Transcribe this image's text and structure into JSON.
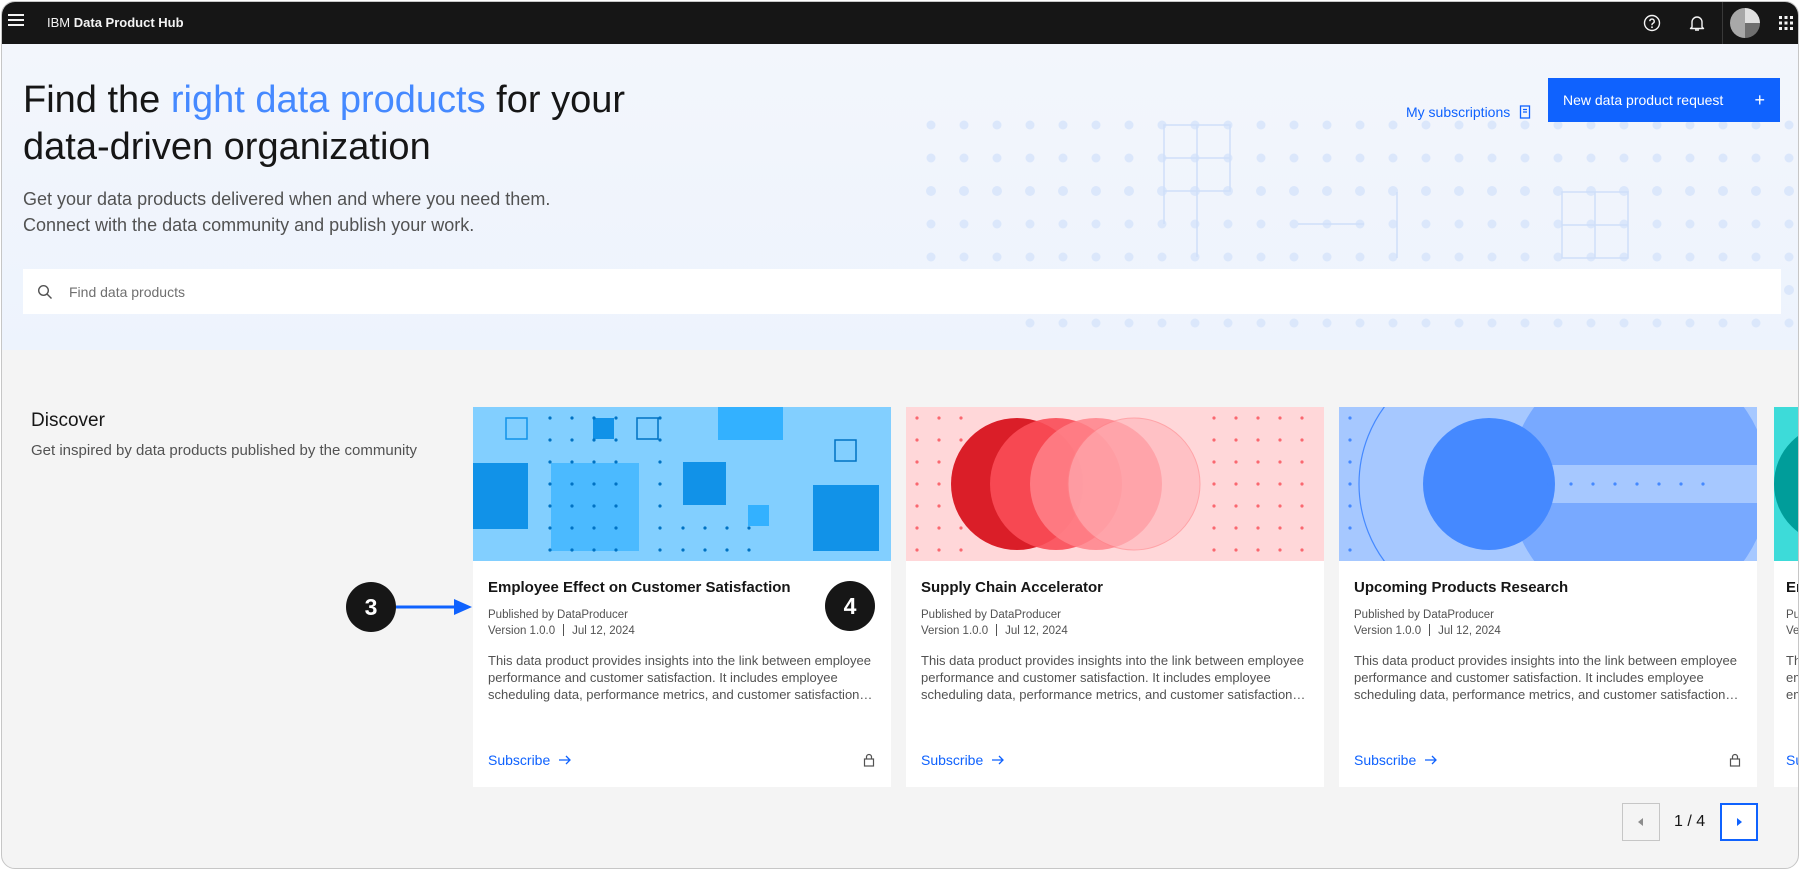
{
  "topbar": {
    "brand_prefix": "IBM",
    "brand_name": "Data Product Hub",
    "icons": [
      "menu-icon",
      "help-icon",
      "notification-icon",
      "avatar",
      "app-switcher-icon"
    ]
  },
  "hero": {
    "title_pre": "Find the ",
    "title_accent": "right data products",
    "title_post": " for your data-driven organization",
    "subtitle_line1": "Get your data products delivered when and where you need them.",
    "subtitle_line2": "Connect with the data community and publish your work.",
    "my_subscriptions": "My subscriptions",
    "new_request": "New data product request",
    "new_request_icon": "+",
    "search_placeholder": "Find data products"
  },
  "discover": {
    "title": "Discover",
    "subtitle": "Get inspired by data products published by the community"
  },
  "cards": [
    {
      "title": "Employee Effect on Customer Satisfaction",
      "publisher": "Published by DataProducer",
      "version": "Version 1.0.0",
      "date": "Jul 12, 2024",
      "description": "This data product provides insights into the link between employee performance and customer satisfaction. It includes employee scheduling data, performance metrics, and customer satisfaction data.",
      "link": "Subscribe",
      "locked": true
    },
    {
      "title": "Supply Chain Accelerator",
      "publisher": "Published by DataProducer",
      "version": "Version 1.0.0",
      "date": "Jul 12, 2024",
      "description": "This data product provides insights into the link between employee performance and customer satisfaction. It includes employee scheduling data, performance metrics, and customer satisfaction data.",
      "link": "Subscribe",
      "locked": false
    },
    {
      "title": "Upcoming Products Research",
      "publisher": "Published by DataProducer",
      "version": "Version 1.0.0",
      "date": "Jul 12, 2024",
      "description": "This data product provides insights into the link between employee performance and customer satisfaction. It includes employee scheduling data, performance metrics, and customer satisfaction data.",
      "link": "Subscribe",
      "locked": true
    }
  ],
  "partial_card": {
    "title": "Em",
    "line1": "Pul",
    "line2": "Ve",
    "line3": "Th",
    "line4": "em",
    "line5": "em",
    "link": "Su"
  },
  "annotations": {
    "step_a": "3",
    "step_b": "4"
  },
  "pagination": {
    "label": "1 / 4"
  },
  "colors": {
    "accent": "#0f62fe",
    "accent_light": "#4589ff",
    "topbar": "#161616"
  }
}
